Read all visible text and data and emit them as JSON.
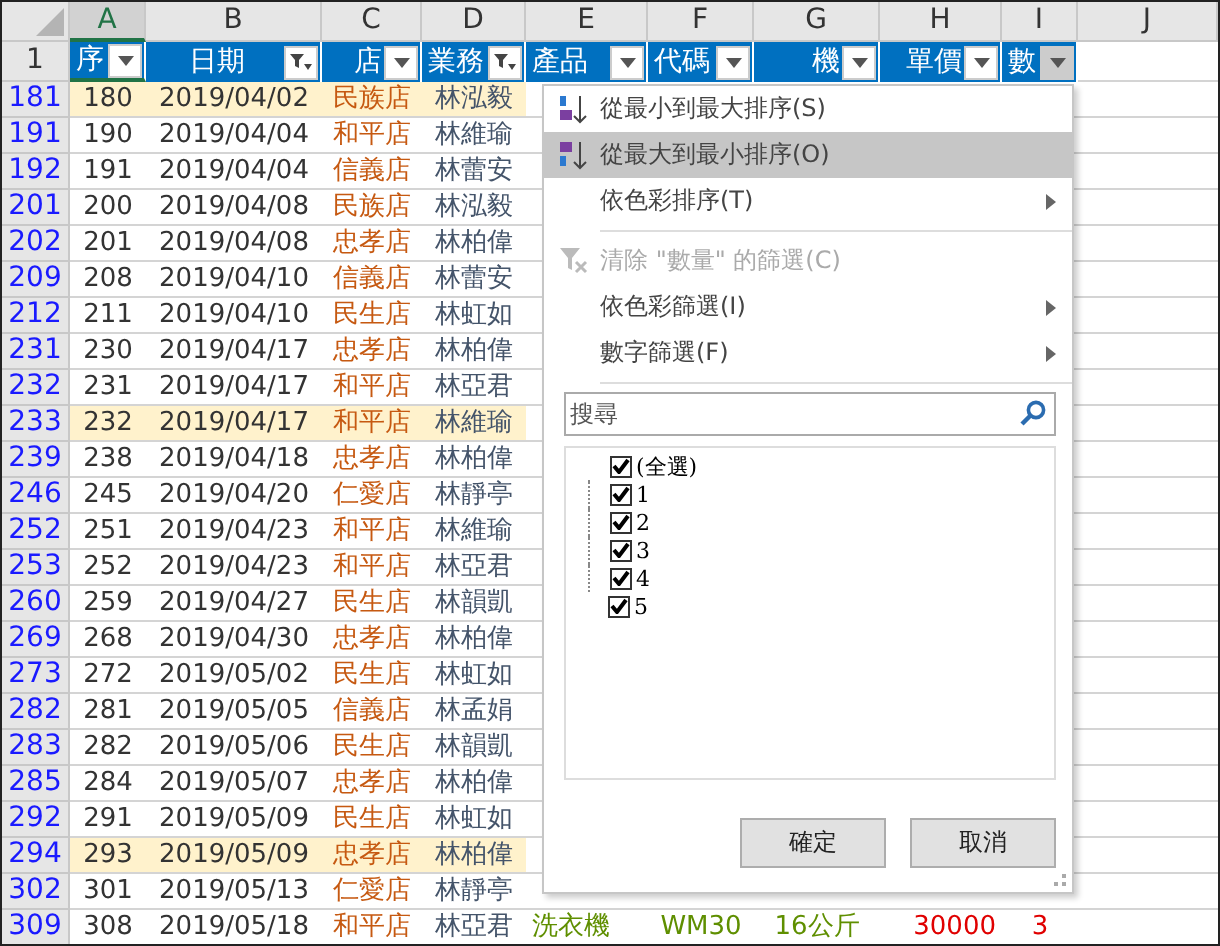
{
  "columns": [
    {
      "letter": "A",
      "selected": true
    },
    {
      "letter": "B",
      "selected": false
    },
    {
      "letter": "C",
      "selected": false
    },
    {
      "letter": "D",
      "selected": false
    },
    {
      "letter": "E",
      "selected": false
    },
    {
      "letter": "F",
      "selected": false
    },
    {
      "letter": "G",
      "selected": false
    },
    {
      "letter": "H",
      "selected": false
    },
    {
      "letter": "I",
      "selected": false
    },
    {
      "letter": "J",
      "selected": false
    }
  ],
  "header_row": {
    "number": "1",
    "cells": [
      {
        "text": "序",
        "filtered": false,
        "menu_open": false
      },
      {
        "text": "日期",
        "filtered": true,
        "menu_open": false
      },
      {
        "text": "店",
        "filtered": false,
        "menu_open": false
      },
      {
        "text": "業務",
        "filtered": true,
        "menu_open": false
      },
      {
        "text": "產品",
        "filtered": false,
        "menu_open": false
      },
      {
        "text": "代碼",
        "filtered": false,
        "menu_open": false
      },
      {
        "text": "機",
        "filtered": false,
        "menu_open": false
      },
      {
        "text": "單價",
        "filtered": false,
        "menu_open": false
      },
      {
        "text": "數",
        "filtered": false,
        "menu_open": true
      }
    ]
  },
  "rows": [
    {
      "number": "181",
      "highlighted": true,
      "cells": [
        "180",
        "2019/04/02",
        "民族店",
        "林泓毅"
      ]
    },
    {
      "number": "191",
      "highlighted": false,
      "cells": [
        "190",
        "2019/04/04",
        "和平店",
        "林維瑜"
      ]
    },
    {
      "number": "192",
      "highlighted": false,
      "cells": [
        "191",
        "2019/04/04",
        "信義店",
        "林蕾安"
      ]
    },
    {
      "number": "201",
      "highlighted": false,
      "cells": [
        "200",
        "2019/04/08",
        "民族店",
        "林泓毅"
      ]
    },
    {
      "number": "202",
      "highlighted": false,
      "cells": [
        "201",
        "2019/04/08",
        "忠孝店",
        "林柏偉"
      ]
    },
    {
      "number": "209",
      "highlighted": false,
      "cells": [
        "208",
        "2019/04/10",
        "信義店",
        "林蕾安"
      ]
    },
    {
      "number": "212",
      "highlighted": false,
      "cells": [
        "211",
        "2019/04/10",
        "民生店",
        "林虹如"
      ]
    },
    {
      "number": "231",
      "highlighted": false,
      "cells": [
        "230",
        "2019/04/17",
        "忠孝店",
        "林柏偉"
      ]
    },
    {
      "number": "232",
      "highlighted": false,
      "cells": [
        "231",
        "2019/04/17",
        "和平店",
        "林亞君"
      ]
    },
    {
      "number": "233",
      "highlighted": true,
      "cells": [
        "232",
        "2019/04/17",
        "和平店",
        "林維瑜"
      ]
    },
    {
      "number": "239",
      "highlighted": false,
      "cells": [
        "238",
        "2019/04/18",
        "忠孝店",
        "林柏偉"
      ]
    },
    {
      "number": "246",
      "highlighted": false,
      "cells": [
        "245",
        "2019/04/20",
        "仁愛店",
        "林靜亭"
      ]
    },
    {
      "number": "252",
      "highlighted": false,
      "cells": [
        "251",
        "2019/04/23",
        "和平店",
        "林維瑜"
      ]
    },
    {
      "number": "253",
      "highlighted": false,
      "cells": [
        "252",
        "2019/04/23",
        "和平店",
        "林亞君"
      ]
    },
    {
      "number": "260",
      "highlighted": false,
      "cells": [
        "259",
        "2019/04/27",
        "民生店",
        "林韻凱"
      ]
    },
    {
      "number": "269",
      "highlighted": false,
      "cells": [
        "268",
        "2019/04/30",
        "忠孝店",
        "林柏偉"
      ]
    },
    {
      "number": "273",
      "highlighted": false,
      "cells": [
        "272",
        "2019/05/02",
        "民生店",
        "林虹如"
      ]
    },
    {
      "number": "282",
      "highlighted": false,
      "cells": [
        "281",
        "2019/05/05",
        "信義店",
        "林孟娟"
      ]
    },
    {
      "number": "283",
      "highlighted": false,
      "cells": [
        "282",
        "2019/05/06",
        "民生店",
        "林韻凱"
      ]
    },
    {
      "number": "285",
      "highlighted": false,
      "cells": [
        "284",
        "2019/05/07",
        "忠孝店",
        "林柏偉"
      ]
    },
    {
      "number": "292",
      "highlighted": false,
      "cells": [
        "291",
        "2019/05/09",
        "民生店",
        "林虹如"
      ]
    },
    {
      "number": "294",
      "highlighted": true,
      "cells": [
        "293",
        "2019/05/09",
        "忠孝店",
        "林柏偉"
      ]
    },
    {
      "number": "302",
      "highlighted": false,
      "cells": [
        "301",
        "2019/05/13",
        "仁愛店",
        "林靜亭"
      ]
    },
    {
      "number": "309",
      "highlighted": false,
      "cells": [
        "308",
        "2019/05/18",
        "和平店",
        "林亞君",
        "洗衣機",
        "WM30",
        "16公斤",
        "30000",
        "3"
      ]
    }
  ],
  "filter_menu": {
    "items": [
      {
        "kind": "sort_asc",
        "label": "從最小到最大排序(S)",
        "highlighted": false,
        "disabled": false,
        "submenu": false
      },
      {
        "kind": "sort_desc",
        "label": "從最大到最小排序(O)",
        "highlighted": true,
        "disabled": false,
        "submenu": false
      },
      {
        "kind": "plain",
        "label": "依色彩排序(T)",
        "highlighted": false,
        "disabled": false,
        "submenu": true
      },
      {
        "kind": "separator"
      },
      {
        "kind": "clear",
        "label": "清除 \"數量\" 的篩選(C)",
        "highlighted": false,
        "disabled": true,
        "submenu": false
      },
      {
        "kind": "plain",
        "label": "依色彩篩選(I)",
        "highlighted": false,
        "disabled": false,
        "submenu": true
      },
      {
        "kind": "plain",
        "label": "數字篩選(F)",
        "highlighted": false,
        "disabled": false,
        "submenu": true
      },
      {
        "kind": "separator"
      }
    ],
    "search": {
      "placeholder": "搜尋"
    },
    "checklist": [
      {
        "label": "(全選)",
        "checked": true,
        "children": [
          {
            "label": "1",
            "checked": true
          },
          {
            "label": "2",
            "checked": true
          },
          {
            "label": "3",
            "checked": true
          },
          {
            "label": "4",
            "checked": true
          },
          {
            "label": "5",
            "checked": true
          }
        ]
      }
    ],
    "buttons": [
      "確定",
      "取消"
    ]
  }
}
